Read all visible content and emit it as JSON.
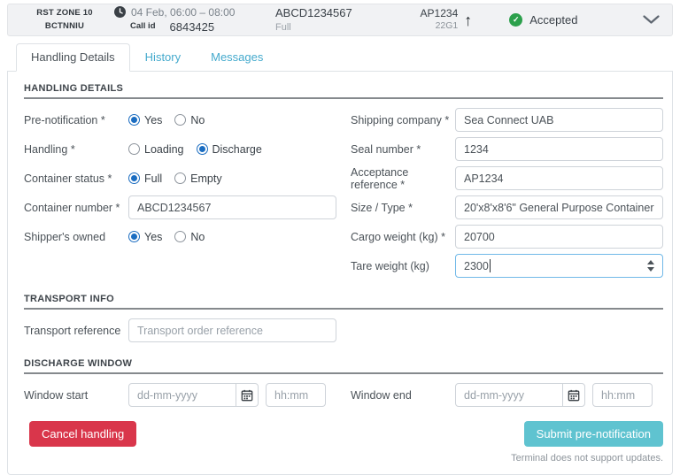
{
  "header": {
    "zone": "RST ZONE 10",
    "code": "BCTNNIU",
    "schedule": "04 Feb, 06:00 – 08:00",
    "call_id_label": "Call id",
    "call_id_value": "6843425",
    "container_number": "ABCD1234567",
    "container_status": "Full",
    "reference": "AP1234",
    "iso_code": "22G1",
    "status_label": "Accepted"
  },
  "icons": {
    "arrow_up": "↑",
    "check": "✓"
  },
  "tabs": [
    {
      "label": "Handling Details",
      "active": true
    },
    {
      "label": "History",
      "active": false
    },
    {
      "label": "Messages",
      "active": false
    }
  ],
  "handling": {
    "title": "HANDLING DETAILS",
    "pre_notification": {
      "label": "Pre-notification *",
      "options": [
        "Yes",
        "No"
      ],
      "selected": "Yes"
    },
    "handling_type": {
      "label": "Handling *",
      "options": [
        "Loading",
        "Discharge"
      ],
      "selected": "Discharge"
    },
    "container_status": {
      "label": "Container status *",
      "options": [
        "Full",
        "Empty"
      ],
      "selected": "Full"
    },
    "container_number": {
      "label": "Container number *",
      "value": "ABCD1234567"
    },
    "shippers_owned": {
      "label": "Shipper's owned",
      "options": [
        "Yes",
        "No"
      ],
      "selected": "Yes"
    },
    "shipping_company": {
      "label": "Shipping company *",
      "value": "Sea Connect UAB"
    },
    "seal_number": {
      "label": "Seal number *",
      "value": "1234"
    },
    "acceptance_reference": {
      "label": "Acceptance reference *",
      "value": "AP1234"
    },
    "size_type": {
      "label": "Size / Type *",
      "value": "20'x8'x8'6\" General Purpose Container"
    },
    "cargo_weight": {
      "label": "Cargo weight (kg) *",
      "value": "20700"
    },
    "tare_weight": {
      "label": "Tare weight (kg)",
      "value": "2300"
    }
  },
  "transport": {
    "title": "TRANSPORT INFO",
    "transport_reference": {
      "label": "Transport reference",
      "placeholder": "Transport order reference"
    }
  },
  "discharge_window": {
    "title": "DISCHARGE WINDOW",
    "window_start": {
      "label": "Window start",
      "date_placeholder": "dd-mm-yyyy",
      "time_placeholder": "hh:mm"
    },
    "window_end": {
      "label": "Window end",
      "date_placeholder": "dd-mm-yyyy",
      "time_placeholder": "hh:mm"
    }
  },
  "actions": {
    "cancel_label": "Cancel handling",
    "submit_label": "Submit pre-notification",
    "note": "Terminal does not support updates."
  },
  "colors": {
    "accent_blue": "#1b6dc1",
    "tab_link": "#45aacd",
    "status_green": "#2ca04c",
    "danger_red": "#d9364b",
    "submit_teal": "#5fc3d0"
  }
}
